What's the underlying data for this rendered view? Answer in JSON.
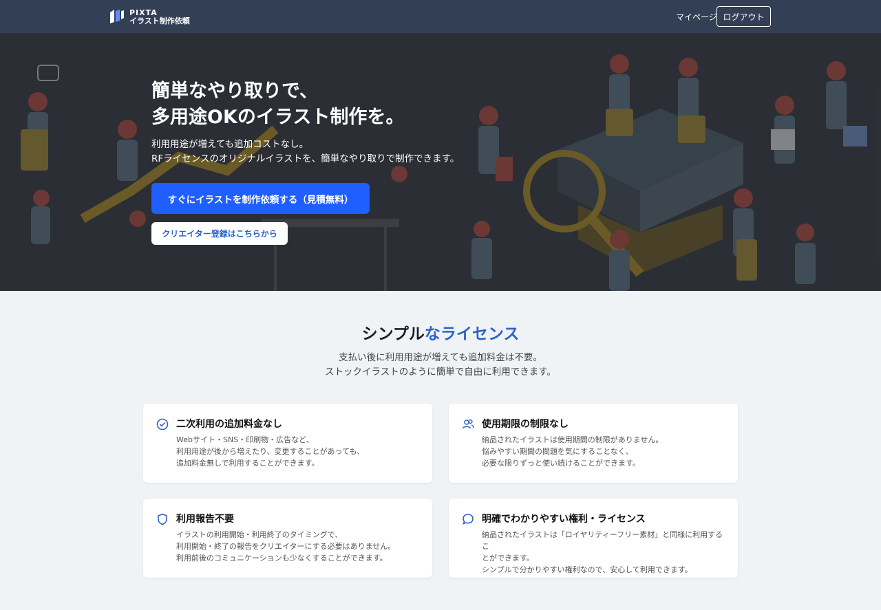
{
  "header": {
    "logo_brand": "PIXTA",
    "logo_sub": "イラスト制作依頼",
    "mypage_label": "マイページ",
    "logout_label": "ログアウト"
  },
  "hero": {
    "title": "簡単なやり取りで、\n多用途OKのイラスト制作を。",
    "description": "利用用途が増えても追加コストなし。\nRFライセンスのオリジナルイラストを、簡単なやり取りで制作できます。",
    "cta_label": "すぐにイラストを制作依頼する（見積無料）",
    "creator_label": "クリエイター登録はこちらから"
  },
  "license": {
    "title_plain": "シンプル",
    "title_accent": "なライセンス",
    "description": "支払い後に利用用途が増えても追加料金は不要。\nストックイラストのように簡単で自由に利用できます。",
    "cards": [
      {
        "icon": "check-badge-icon",
        "title": "二次利用の追加料金なし",
        "text": "Webサイト・SNS・印刷物・広告など、\n利用用途が後から増えたり、変更することがあっても、\n追加料金無しで利用することができます。"
      },
      {
        "icon": "users-icon",
        "title": "使用期限の制限なし",
        "text": "納品されたイラストは使用期間の制限がありません。\n悩みやすい期間の問題を気にすることなく、\n必要な限りずっと使い続けることができます。"
      },
      {
        "icon": "shield-icon",
        "title": "利用報告不要",
        "text": "イラストの利用開始・利用終了のタイミングで、\n利用開始・終了の報告をクリエイターにする必要はありません。\n利用前後のコミュニケーションも少なくすることができます。"
      },
      {
        "icon": "chat-bubble-icon",
        "title": "明確でわかりやすい権利・ライセンス",
        "text": "納品されたイラストは「ロイヤリティーフリー素材」と同様に利用するこ\nとができます。\nシンプルで分かりやすい権利なので、安心して利用できます。"
      }
    ]
  },
  "colors": {
    "header_bg": "#333f55",
    "primary": "#1f5fff",
    "accent_text": "#2b62c8",
    "page_bg": "#f0f3f5"
  }
}
